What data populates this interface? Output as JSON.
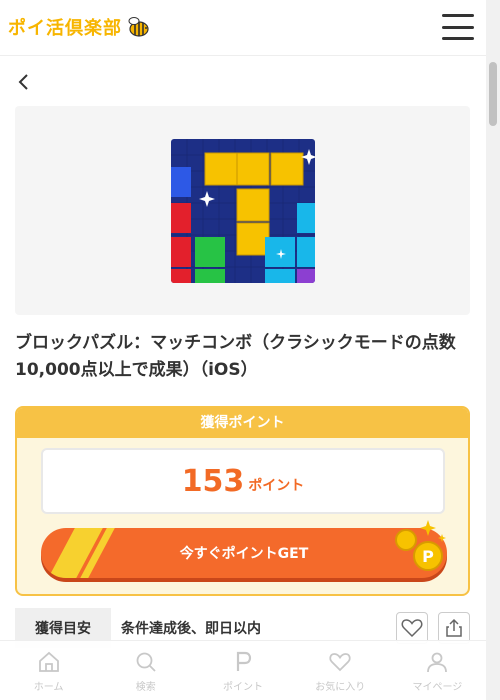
{
  "header": {
    "logo_text": "ポイ活倶楽部",
    "logo_icon": "bee-icon",
    "menu_icon": "hamburger-menu-icon"
  },
  "nav_back_icon": "chevron-left-icon",
  "offer": {
    "app_icon": "block-puzzle-app-icon",
    "title": "ブロックパズル：マッチコンボ（クラシックモードの点数10,000点以上で成果）（iOS）"
  },
  "points": {
    "header_label": "獲得ポイント",
    "value": "153",
    "unit": "ポイント",
    "get_button_label": "今すぐポイントGET"
  },
  "estimate": {
    "label": "獲得目安",
    "value": "条件達成後、即日以内"
  },
  "actions": {
    "favorite_icon": "heart-icon",
    "share_icon": "share-icon"
  },
  "bottom_nav": {
    "items": [
      {
        "label": "ホーム",
        "icon": "home-icon"
      },
      {
        "label": "検索",
        "icon": "search-icon"
      },
      {
        "label": "ポイント",
        "icon": "point-icon"
      },
      {
        "label": "お気に入り",
        "icon": "heart-icon"
      },
      {
        "label": "マイページ",
        "icon": "person-icon"
      }
    ]
  },
  "colors": {
    "brand_yellow": "#f7b500",
    "accent_orange": "#f26a25",
    "box_border": "#f7c245"
  }
}
